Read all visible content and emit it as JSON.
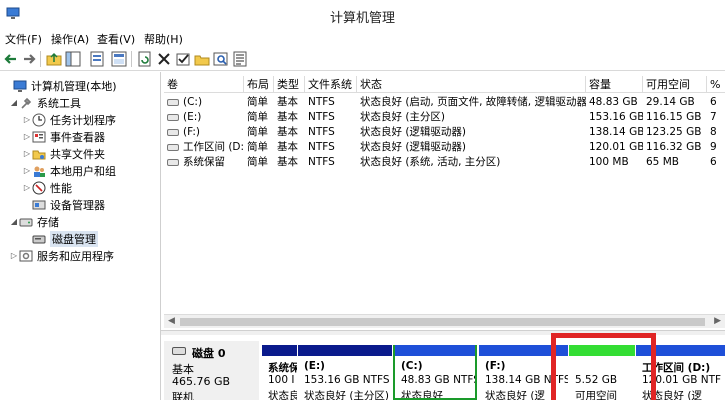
{
  "window": {
    "title": "计算机管理"
  },
  "menu": [
    "文件(F)",
    "操作(A)",
    "查看(V)",
    "帮助(H)"
  ],
  "toolbar_icons": [
    "back-arrow-icon",
    "forward-arrow-icon",
    "up-folder-icon",
    "show-tree-icon",
    "properties-icon",
    "help-icon",
    "properties-sheet-icon",
    "refresh-icon",
    "delete-icon",
    "check-icon",
    "open-folder-icon",
    "search-icon",
    "export-list-icon"
  ],
  "tree": [
    {
      "label": "计算机管理(本地)",
      "icon": "computer-management-icon"
    },
    {
      "label": "系统工具",
      "icon": "system-tools-icon"
    },
    {
      "label": "任务计划程序",
      "icon": "task-scheduler-icon"
    },
    {
      "label": "事件查看器",
      "icon": "event-viewer-icon"
    },
    {
      "label": "共享文件夹",
      "icon": "shared-folders-icon"
    },
    {
      "label": "本地用户和组",
      "icon": "local-users-icon"
    },
    {
      "label": "性能",
      "icon": "performance-icon"
    },
    {
      "label": "设备管理器",
      "icon": "device-manager-icon"
    },
    {
      "label": "存储",
      "icon": "storage-icon"
    },
    {
      "label": "磁盘管理",
      "icon": "disk-management-icon"
    },
    {
      "label": "服务和应用程序",
      "icon": "services-icon"
    }
  ],
  "volumes": {
    "headers": [
      "卷",
      "布局",
      "类型",
      "文件系统",
      "状态",
      "容量",
      "可用空间",
      "%"
    ],
    "rows": [
      [
        "(C:)",
        "简单",
        "基本",
        "NTFS",
        "状态良好 (启动, 页面文件, 故障转储, 逻辑驱动器)",
        "48.83 GB",
        "29.14 GB",
        "6"
      ],
      [
        "(E:)",
        "简单",
        "基本",
        "NTFS",
        "状态良好 (主分区)",
        "153.16 GB",
        "116.15 GB",
        "7"
      ],
      [
        "(F:)",
        "简单",
        "基本",
        "NTFS",
        "状态良好 (逻辑驱动器)",
        "138.14 GB",
        "123.25 GB",
        "8"
      ],
      [
        "工作区间 (D:)",
        "简单",
        "基本",
        "NTFS",
        "状态良好 (逻辑驱动器)",
        "120.01 GB",
        "116.32 GB",
        "9"
      ],
      [
        "系统保留",
        "简单",
        "基本",
        "NTFS",
        "状态良好 (系统, 活动, 主分区)",
        "100 MB",
        "65 MB",
        "6"
      ]
    ]
  },
  "disk": {
    "name": "磁盘 0",
    "type": "基本",
    "size": "465.76 GB",
    "status": "联机",
    "partitions": [
      {
        "name": "系统保",
        "size": "100 I",
        "status": "状态良",
        "bar_color": "#0a1a8c"
      },
      {
        "name": "(E:)",
        "size": "153.16 GB NTFS",
        "status": "状态良好 (主分区)",
        "bar_color": "#0a1a8c"
      },
      {
        "name": "(C:)",
        "size": "48.83 GB NTFS",
        "status": "状态良好",
        "bar_color": "#1e4fd8"
      },
      {
        "name": "(F:)",
        "size": "138.14 GB NTFS",
        "status": "状态良好 (逻",
        "bar_color": "#1e4fd8"
      },
      {
        "name": "",
        "size": "5.52 GB",
        "status": "可用空间",
        "bar_color": "#33dd33"
      },
      {
        "name": "工作区间 (D:)",
        "size": "120.01 GB NTF",
        "status": "状态良好 (逻",
        "bar_color": "#1e4fd8"
      }
    ]
  }
}
